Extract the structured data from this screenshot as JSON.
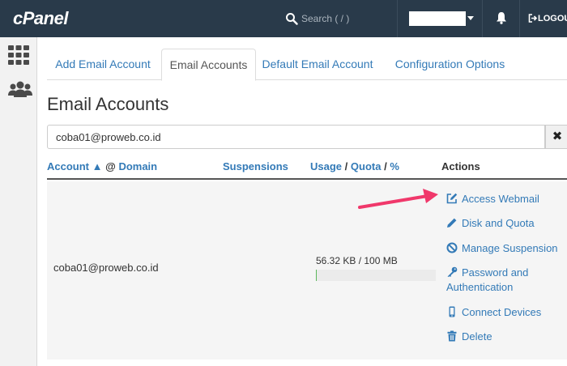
{
  "header": {
    "logo": "cPanel",
    "search_placeholder": "Search ( / )",
    "logout_label": "LOGOU"
  },
  "sidebar": {
    "items": [
      {
        "icon": "grid-icon"
      },
      {
        "icon": "users-icon"
      }
    ]
  },
  "tabs": [
    {
      "label": "Add Email Account",
      "active": false
    },
    {
      "label": "Email Accounts",
      "active": true
    },
    {
      "label": "Default Email Account",
      "active": false
    },
    {
      "label": "Configuration Options",
      "active": false
    }
  ],
  "page_title": "Email Accounts",
  "filter": {
    "value": "coba01@proweb.co.id",
    "clear_label": "✖"
  },
  "table": {
    "headers": {
      "account": "Account",
      "sort_indicator": "▲",
      "at": "@",
      "domain": "Domain",
      "suspensions": "Suspensions",
      "usage": "Usage",
      "slash1": "/",
      "quota": "Quota",
      "slash2": "/",
      "percent": "%",
      "actions": "Actions"
    },
    "rows": [
      {
        "account": "coba01@proweb.co.id",
        "usage_text": "56.32 KB / 100 MB",
        "usage_fraction": 0.0006,
        "actions": [
          {
            "label": "Access Webmail",
            "icon": "external-edit-icon"
          },
          {
            "label": "Disk and Quota",
            "icon": "pencil-icon"
          },
          {
            "label": "Manage Suspension",
            "icon": "ban-icon"
          },
          {
            "label": "Password and Authentication",
            "icon": "key-icon"
          },
          {
            "label": "Connect Devices",
            "icon": "mobile-icon"
          },
          {
            "label": "Delete",
            "icon": "trash-icon"
          }
        ]
      }
    ]
  },
  "colors": {
    "header_bg": "#293a4a",
    "link": "#337ab7",
    "arrow": "#f0386b"
  }
}
